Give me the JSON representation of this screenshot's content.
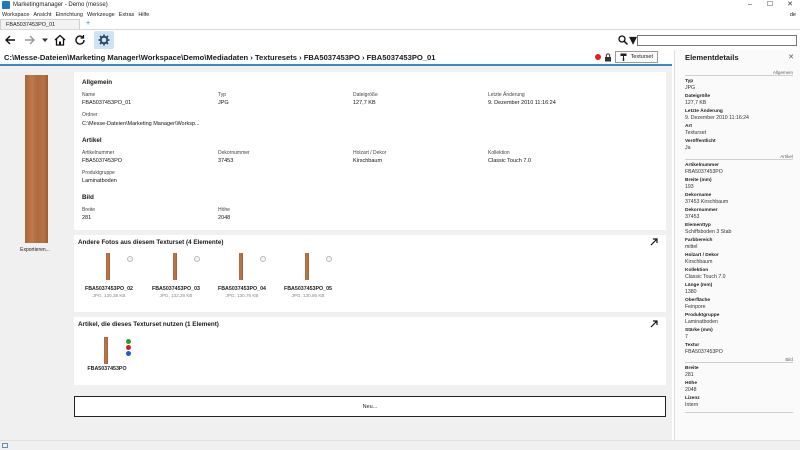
{
  "window": {
    "title": "Marketingmanager - Demo (messe)",
    "minimize": "–",
    "maximize": "☐",
    "close": "✕"
  },
  "menu": {
    "items": [
      "Workspace",
      "Ansicht",
      "Einrichtung",
      "Werkzeuge",
      "Extras",
      "Hilfe"
    ],
    "language": "de"
  },
  "tabs": {
    "active": "FBA5037453PO_01",
    "add": "+"
  },
  "toolbar": {
    "search_placeholder": "",
    "search_dropdown": "▾"
  },
  "breadcrumb": "C:\\Messe-Dateien\\Marketing Manager\\Workspace\\Demo\\Mediadaten › Texturesets › FBA5037453PO › FBA5037453PO_01",
  "texturset_button": "Texturset",
  "left": {
    "export_label": "Exportieren..."
  },
  "allgemein": {
    "title": "Allgemein",
    "name_label": "Name",
    "name": "FBA5037453PO_01",
    "typ_label": "Typ",
    "typ": "JPG",
    "size_label": "Dateigröße",
    "size": "127,7 KB",
    "changed_label": "Letzte Änderung",
    "changed": "9. Dezember 2010 11:16:24",
    "folder_label": "Ordner",
    "folder": "C:\\Messe-Dateien\\Marketing Manager\\Worksp..."
  },
  "artikel": {
    "title": "Artikel",
    "nr_label": "Artikelnummer",
    "nr": "FBA5037453PO",
    "dekor_label": "Dekornummer",
    "dekor": "37453",
    "holz_label": "Holzart / Dekor",
    "holz": "Kirschbaum",
    "kollektion_label": "Kollektion",
    "kollektion": "Classic Touch 7.0",
    "gruppe_label": "Produktgruppe",
    "gruppe": "Laminatboden"
  },
  "bild": {
    "title": "Bild",
    "breite_label": "Breite",
    "breite": "281",
    "hoehe_label": "Höhe",
    "hoehe": "2048"
  },
  "photos": {
    "title": "Andere Fotos aus diesem Texturset  (4 Elemente)",
    "items": [
      {
        "name": "FBA5037453PO_02",
        "meta": "JPG, 130,38 KB"
      },
      {
        "name": "FBA5037453PO_03",
        "meta": "JPG, 132,26 KB"
      },
      {
        "name": "FBA5037453PO_04",
        "meta": "JPG, 130,76 KB"
      },
      {
        "name": "FBA5037453PO_05",
        "meta": "JPG, 130,86 KB"
      }
    ]
  },
  "articles": {
    "title": "Artikel, die dieses Texturset nutzen  (1 Element)",
    "items": [
      {
        "name": "FBA5037453PO"
      }
    ],
    "flag_colors": [
      "#2a9d2a",
      "#d02020",
      "#1e5bc8"
    ]
  },
  "new_button": "Neu...",
  "details": {
    "title": "Elementdetails",
    "close": "✕",
    "section_allgemein": "Allgemein",
    "section_artikel": "Artikel",
    "section_bild": "Bild",
    "allgemein": [
      {
        "label": "Typ",
        "value": "JPG"
      },
      {
        "label": "Dateigröße",
        "value": "127,7 KB"
      },
      {
        "label": "Letzte Änderung",
        "value": "9. Dezember 2010 11:16:24"
      },
      {
        "label": "Art",
        "value": "Texturset"
      },
      {
        "label": "Veröffentlicht",
        "value": "Ja"
      }
    ],
    "artikel": [
      {
        "label": "Artikelnummer",
        "value": "FBA5037453PO"
      },
      {
        "label": "Breite (mm)",
        "value": "193"
      },
      {
        "label": "Dekorname",
        "value": "37453 Kirschbaum"
      },
      {
        "label": "Dekornummer",
        "value": "37453"
      },
      {
        "label": "Elementtyp",
        "value": "Schiffsboden 3 Stab"
      },
      {
        "label": "Farbbereich",
        "value": "mittel"
      },
      {
        "label": "Holzart / Dekor",
        "value": "Kirschbaum"
      },
      {
        "label": "Kollektion",
        "value": "Classic Touch 7.0"
      },
      {
        "label": "Länge (mm)",
        "value": "1380"
      },
      {
        "label": "Oberfläche",
        "value": "Feinpore"
      },
      {
        "label": "Produktgruppe",
        "value": "Laminatboden"
      },
      {
        "label": "Stärke (mm)",
        "value": "7"
      },
      {
        "label": "Textur",
        "value": "FBA5037453PO"
      }
    ],
    "bild": [
      {
        "label": "Breite",
        "value": "281"
      },
      {
        "label": "Höhe",
        "value": "2048"
      },
      {
        "label": "Lizenz",
        "value": "Intern"
      }
    ]
  }
}
